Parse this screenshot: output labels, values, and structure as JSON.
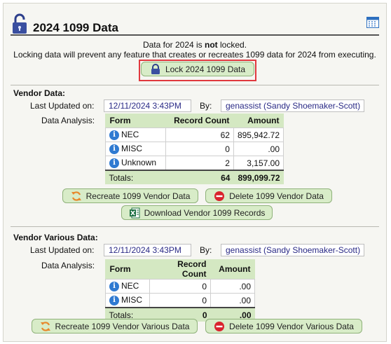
{
  "header": {
    "title": "2024 1099 Data"
  },
  "notice": {
    "line1_pre": "Data for 2024 is ",
    "line1_bold": "not",
    "line1_post": " locked.",
    "line2": "Locking data will prevent any feature that creates or recreates 1099 data for 2024 from executing."
  },
  "lock_button": "Lock 2024 1099 Data",
  "vendor": {
    "section_title": "Vendor Data:",
    "last_updated_label": "Last Updated on:",
    "last_updated_value": "12/11/2024 3:43PM",
    "by_label": "By:",
    "by_value": "genassist (Sandy Shoemaker-Scott)",
    "analysis_label": "Data Analysis:",
    "table": {
      "headers": [
        "Form",
        "Record Count",
        "Amount"
      ],
      "rows": [
        {
          "form": "NEC",
          "count": "62",
          "amount": "895,942.72"
        },
        {
          "form": "MISC",
          "count": "0",
          "amount": ".00"
        },
        {
          "form": "Unknown",
          "count": "2",
          "amount": "3,157.00"
        }
      ],
      "totals": {
        "label": "Totals:",
        "count": "64",
        "amount": "899,099.72"
      }
    },
    "recreate_button": "Recreate 1099 Vendor Data",
    "delete_button": "Delete 1099 Vendor Data",
    "download_button": "Download Vendor 1099 Records"
  },
  "various": {
    "section_title": "Vendor Various Data:",
    "last_updated_label": "Last Updated on:",
    "last_updated_value": "12/11/2024 3:43PM",
    "by_label": "By:",
    "by_value": "genassist (Sandy Shoemaker-Scott)",
    "analysis_label": "Data Analysis:",
    "table": {
      "headers": [
        "Form",
        "Record Count",
        "Amount"
      ],
      "rows": [
        {
          "form": "NEC",
          "count": "0",
          "amount": ".00"
        },
        {
          "form": "MISC",
          "count": "0",
          "amount": ".00"
        }
      ],
      "totals": {
        "label": "Totals:",
        "count": "0",
        "amount": ".00"
      }
    },
    "recreate_button": "Recreate 1099 Vendor Various Data",
    "delete_button": "Delete 1099 Vendor Various Data"
  },
  "icons": {
    "title": "unlocked-padlock-icon",
    "calendar": "calendar-icon",
    "lock": "padlock-icon",
    "info": "info-icon",
    "recreate": "refresh-icon",
    "delete": "delete-circle-icon",
    "download": "excel-icon"
  },
  "colors": {
    "button_bg": "#d8ecc8",
    "table_bg": "#d4e8c2",
    "value_text": "#2a2a86",
    "highlight": "#e0393e",
    "delete_red": "#d9232d",
    "info_blue": "#2f7ad1"
  }
}
